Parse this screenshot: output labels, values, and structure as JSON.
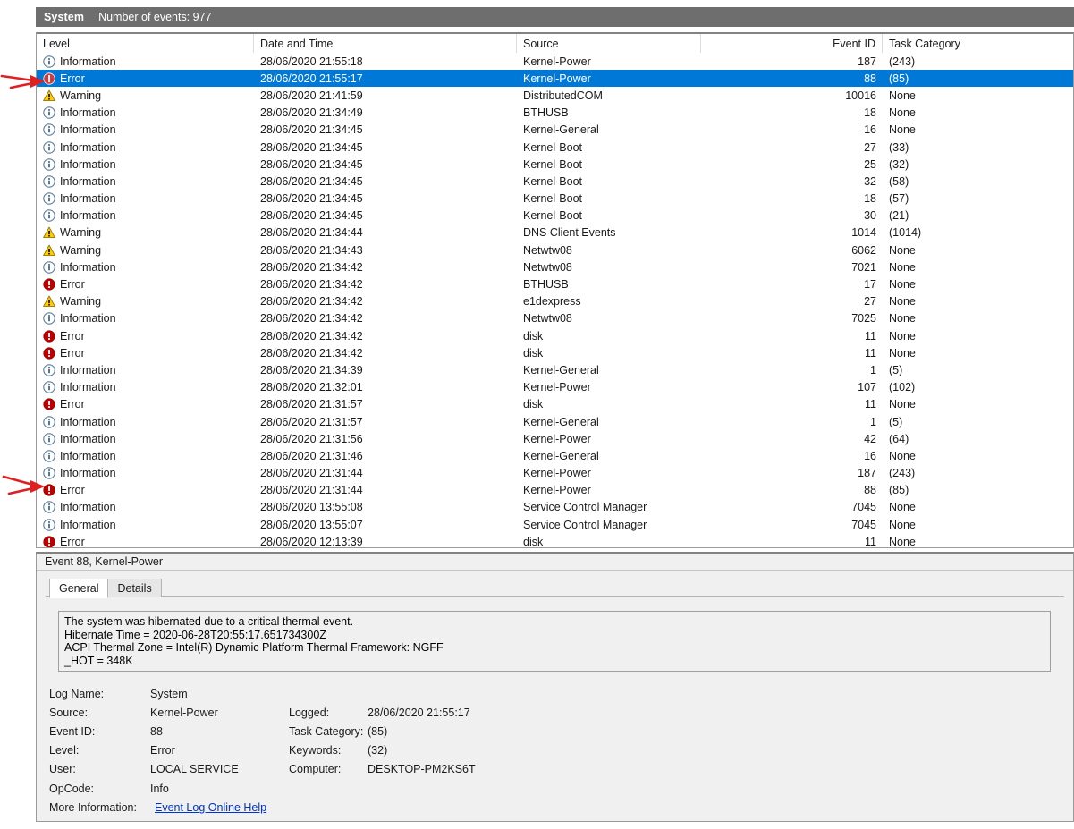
{
  "log_header": {
    "log_name": "System",
    "events_count_label": "Number of events: 977"
  },
  "columns": [
    {
      "key": "level",
      "label": "Level"
    },
    {
      "key": "date",
      "label": "Date and Time"
    },
    {
      "key": "source",
      "label": "Source"
    },
    {
      "key": "event_id",
      "label": "Event ID"
    },
    {
      "key": "task",
      "label": "Task Category"
    }
  ],
  "colors": {
    "selection_blue": "#0078d7",
    "header_gray": "#6e6e6e",
    "error_red": "#c00000",
    "warning_yellow": "#ffcc00",
    "info_blue": "#4a6f9e",
    "link_blue": "#0033cc",
    "annotation_red": "#e02020"
  },
  "rows": [
    {
      "level": "Information",
      "icon": "information-icon",
      "date": "28/06/2020 21:55:18",
      "source": "Kernel-Power",
      "event_id": "187",
      "task": "(243)",
      "selected": false
    },
    {
      "level": "Error",
      "icon": "error-icon",
      "date": "28/06/2020 21:55:17",
      "source": "Kernel-Power",
      "event_id": "88",
      "task": "(85)",
      "selected": true
    },
    {
      "level": "Warning",
      "icon": "warning-icon",
      "date": "28/06/2020 21:41:59",
      "source": "DistributedCOM",
      "event_id": "10016",
      "task": "None",
      "selected": false
    },
    {
      "level": "Information",
      "icon": "information-icon",
      "date": "28/06/2020 21:34:49",
      "source": "BTHUSB",
      "event_id": "18",
      "task": "None",
      "selected": false
    },
    {
      "level": "Information",
      "icon": "information-icon",
      "date": "28/06/2020 21:34:45",
      "source": "Kernel-General",
      "event_id": "16",
      "task": "None",
      "selected": false
    },
    {
      "level": "Information",
      "icon": "information-icon",
      "date": "28/06/2020 21:34:45",
      "source": "Kernel-Boot",
      "event_id": "27",
      "task": "(33)",
      "selected": false
    },
    {
      "level": "Information",
      "icon": "information-icon",
      "date": "28/06/2020 21:34:45",
      "source": "Kernel-Boot",
      "event_id": "25",
      "task": "(32)",
      "selected": false
    },
    {
      "level": "Information",
      "icon": "information-icon",
      "date": "28/06/2020 21:34:45",
      "source": "Kernel-Boot",
      "event_id": "32",
      "task": "(58)",
      "selected": false
    },
    {
      "level": "Information",
      "icon": "information-icon",
      "date": "28/06/2020 21:34:45",
      "source": "Kernel-Boot",
      "event_id": "18",
      "task": "(57)",
      "selected": false
    },
    {
      "level": "Information",
      "icon": "information-icon",
      "date": "28/06/2020 21:34:45",
      "source": "Kernel-Boot",
      "event_id": "30",
      "task": "(21)",
      "selected": false
    },
    {
      "level": "Warning",
      "icon": "warning-icon",
      "date": "28/06/2020 21:34:44",
      "source": "DNS Client Events",
      "event_id": "1014",
      "task": "(1014)",
      "selected": false
    },
    {
      "level": "Warning",
      "icon": "warning-icon",
      "date": "28/06/2020 21:34:43",
      "source": "Netwtw08",
      "event_id": "6062",
      "task": "None",
      "selected": false
    },
    {
      "level": "Information",
      "icon": "information-icon",
      "date": "28/06/2020 21:34:42",
      "source": "Netwtw08",
      "event_id": "7021",
      "task": "None",
      "selected": false
    },
    {
      "level": "Error",
      "icon": "error-icon",
      "date": "28/06/2020 21:34:42",
      "source": "BTHUSB",
      "event_id": "17",
      "task": "None",
      "selected": false
    },
    {
      "level": "Warning",
      "icon": "warning-icon",
      "date": "28/06/2020 21:34:42",
      "source": "e1dexpress",
      "event_id": "27",
      "task": "None",
      "selected": false
    },
    {
      "level": "Information",
      "icon": "information-icon",
      "date": "28/06/2020 21:34:42",
      "source": "Netwtw08",
      "event_id": "7025",
      "task": "None",
      "selected": false
    },
    {
      "level": "Error",
      "icon": "error-icon",
      "date": "28/06/2020 21:34:42",
      "source": "disk",
      "event_id": "11",
      "task": "None",
      "selected": false
    },
    {
      "level": "Error",
      "icon": "error-icon",
      "date": "28/06/2020 21:34:42",
      "source": "disk",
      "event_id": "11",
      "task": "None",
      "selected": false
    },
    {
      "level": "Information",
      "icon": "information-icon",
      "date": "28/06/2020 21:34:39",
      "source": "Kernel-General",
      "event_id": "1",
      "task": "(5)",
      "selected": false
    },
    {
      "level": "Information",
      "icon": "information-icon",
      "date": "28/06/2020 21:32:01",
      "source": "Kernel-Power",
      "event_id": "107",
      "task": "(102)",
      "selected": false
    },
    {
      "level": "Error",
      "icon": "error-icon",
      "date": "28/06/2020 21:31:57",
      "source": "disk",
      "event_id": "11",
      "task": "None",
      "selected": false
    },
    {
      "level": "Information",
      "icon": "information-icon",
      "date": "28/06/2020 21:31:57",
      "source": "Kernel-General",
      "event_id": "1",
      "task": "(5)",
      "selected": false
    },
    {
      "level": "Information",
      "icon": "information-icon",
      "date": "28/06/2020 21:31:56",
      "source": "Kernel-Power",
      "event_id": "42",
      "task": "(64)",
      "selected": false
    },
    {
      "level": "Information",
      "icon": "information-icon",
      "date": "28/06/2020 21:31:46",
      "source": "Kernel-General",
      "event_id": "16",
      "task": "None",
      "selected": false
    },
    {
      "level": "Information",
      "icon": "information-icon",
      "date": "28/06/2020 21:31:44",
      "source": "Kernel-Power",
      "event_id": "187",
      "task": "(243)",
      "selected": false
    },
    {
      "level": "Error",
      "icon": "error-icon",
      "date": "28/06/2020 21:31:44",
      "source": "Kernel-Power",
      "event_id": "88",
      "task": "(85)",
      "selected": false
    },
    {
      "level": "Information",
      "icon": "information-icon",
      "date": "28/06/2020 13:55:08",
      "source": "Service Control Manager",
      "event_id": "7045",
      "task": "None",
      "selected": false
    },
    {
      "level": "Information",
      "icon": "information-icon",
      "date": "28/06/2020 13:55:07",
      "source": "Service Control Manager",
      "event_id": "7045",
      "task": "None",
      "selected": false
    },
    {
      "level": "Error",
      "icon": "error-icon",
      "date": "28/06/2020 12:13:39",
      "source": "disk",
      "event_id": "11",
      "task": "None",
      "selected": false
    }
  ],
  "detail": {
    "title": "Event 88, Kernel-Power",
    "tabs": [
      {
        "label": "General",
        "active": true
      },
      {
        "label": "Details",
        "active": false
      }
    ],
    "description_lines": [
      "The system was hibernated due to a critical thermal event.",
      "Hibernate Time = 2020-06-28T20:55:17.651734300Z",
      "ACPI Thermal Zone = Intel(R) Dynamic Platform Thermal Framework: NGFF",
      "_HOT = 348K"
    ],
    "properties": [
      {
        "label": "Log Name:",
        "value": "System",
        "label2": "",
        "value2": ""
      },
      {
        "label": "Source:",
        "value": "Kernel-Power",
        "label2": "Logged:",
        "value2": "28/06/2020 21:55:17"
      },
      {
        "label": "Event ID:",
        "value": "88",
        "label2": "Task Category:",
        "value2": "(85)"
      },
      {
        "label": "Level:",
        "value": "Error",
        "label2": "Keywords:",
        "value2": "(32)"
      },
      {
        "label": "User:",
        "value": "LOCAL SERVICE",
        "label2": "Computer:",
        "value2": "DESKTOP-PM2KS6T"
      },
      {
        "label": "OpCode:",
        "value": "Info",
        "label2": "",
        "value2": ""
      }
    ],
    "more_information_label": "More Information:",
    "more_information_link": "Event Log Online Help"
  },
  "annotations": [
    {
      "name": "arrow-pointing-selected-error-row",
      "target_row_index": 1
    },
    {
      "name": "arrow-pointing-error-row",
      "target_row_index": 25
    }
  ]
}
